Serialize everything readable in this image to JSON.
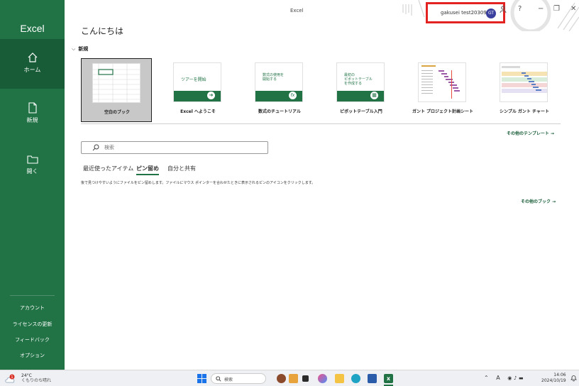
{
  "app": {
    "name": "Excel",
    "window_title": "Excel",
    "brand_color": "#217346"
  },
  "sidebar": {
    "items": [
      {
        "label": "ホーム",
        "icon": "home-icon",
        "active": true
      },
      {
        "label": "新規",
        "icon": "new-file-icon",
        "active": false
      },
      {
        "label": "開く",
        "icon": "open-folder-icon",
        "active": false
      }
    ],
    "bottom": [
      "アカウント",
      "ライセンスの更新",
      "フィードバック",
      "オプション"
    ]
  },
  "account": {
    "username": "gakusei test20309",
    "initials": "GT"
  },
  "window_controls": {
    "icons": [
      "person-icon",
      "help-icon",
      "minimize-icon",
      "restore-icon",
      "close-icon"
    ],
    "help": "?",
    "minimize": "−",
    "restore": "❐",
    "close": "✕"
  },
  "greeting": "こんにちは",
  "new_section": {
    "header": "新規",
    "templates": [
      {
        "label": "空白のブック",
        "icon": "blank-workbook-thumbnail"
      },
      {
        "label": "Excel へようこそ",
        "thumb_text": "ツアーを開始",
        "icon": "arrow-right-icon"
      },
      {
        "label": "数式のチュートリアル",
        "thumb_text": "数式の使用を\n開始する",
        "icon": "fx-icon"
      },
      {
        "label": "ピボットテーブル入門",
        "thumb_text": "最初の\nピボットテーブル\nを作成する",
        "icon": "pivot-table-icon"
      },
      {
        "label": "ガント プロジェクト計画シート",
        "icon": "gantt-thumbnail"
      },
      {
        "label": "シンプル ガント チャート",
        "icon": "gantt-chart-thumbnail"
      }
    ],
    "more_templates": "その他のテンプレート →"
  },
  "search": {
    "placeholder": "検索"
  },
  "tabs": [
    {
      "label": "最近使ったアイテム",
      "active": false
    },
    {
      "label": "ピン留め",
      "active": true
    },
    {
      "label": "自分と共有",
      "active": false
    }
  ],
  "pinned_hint": "後で見つけやすいようにファイルをピン留めします。ファイルにマウス ポインターを合わせたときに表示されるピンのアイコンをクリックします。",
  "more_books": "その他のブック →",
  "taskbar": {
    "temperature": "24°C",
    "weather": "くもりのち晴れ",
    "notification_count": "1",
    "search_placeholder": "検索",
    "time": "14:06",
    "date": "2024/10/19",
    "ime": "A"
  }
}
